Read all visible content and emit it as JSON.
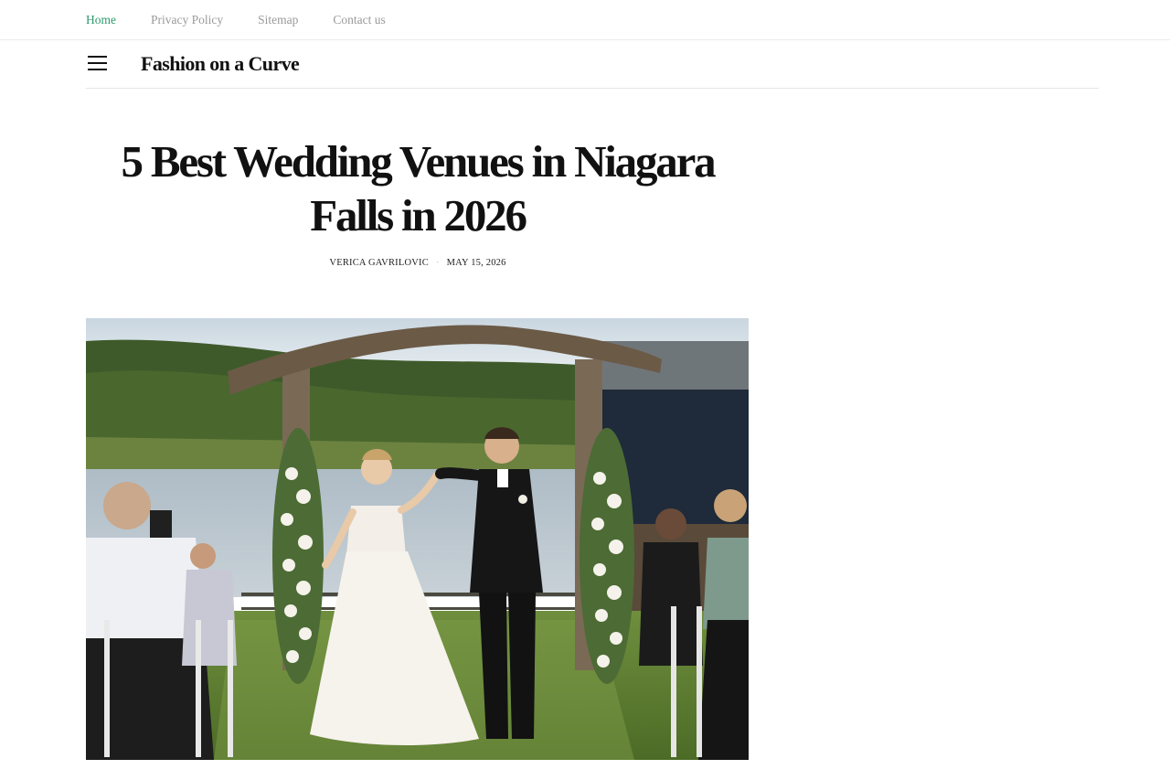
{
  "top_nav": {
    "items": [
      {
        "label": "Home",
        "active": true
      },
      {
        "label": "Privacy Policy",
        "active": false
      },
      {
        "label": "Sitemap",
        "active": false
      },
      {
        "label": "Contact us",
        "active": false
      }
    ]
  },
  "header": {
    "menu_icon": "hamburger-menu-icon",
    "site_title": "Fashion on a Curve"
  },
  "article": {
    "title": "5 Best Wedding Venues in Niagara Falls in 2026",
    "author": "VERICA GAVRILOVIC",
    "date": "MAY 15, 2026",
    "hero_image": "outdoor-wedding-ceremony-photo"
  },
  "colors": {
    "nav_active": "#2e9a6f",
    "nav_inactive": "#9a9a9a",
    "text": "#111111",
    "divider": "#e6e6e6"
  }
}
